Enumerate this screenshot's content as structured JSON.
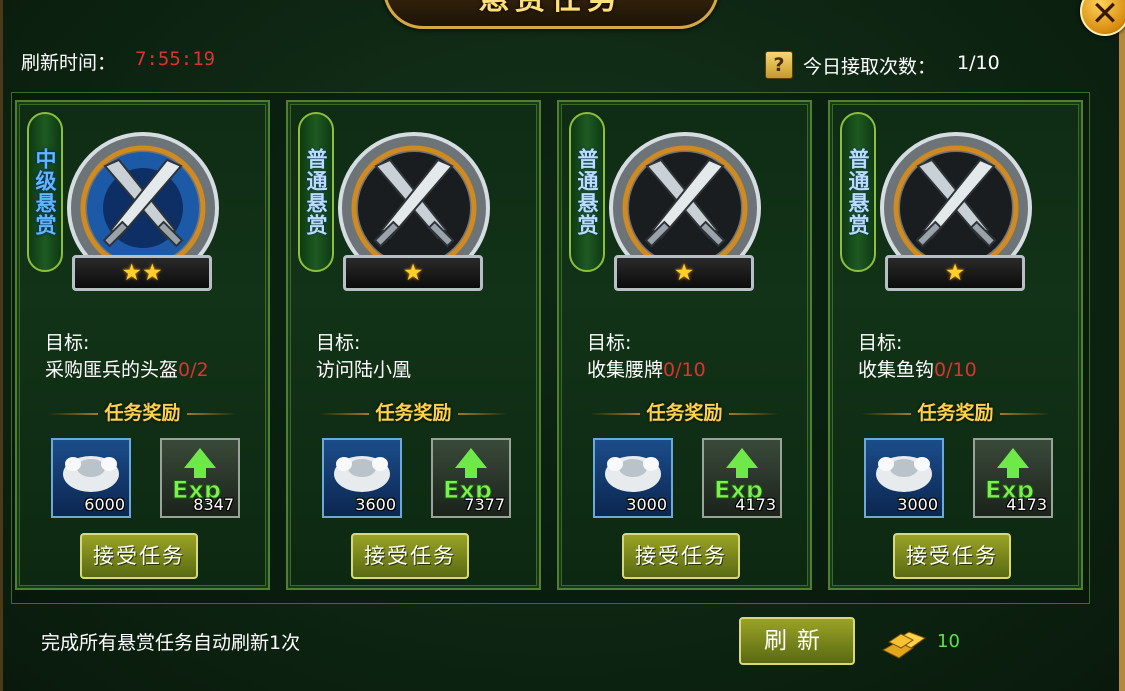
{
  "header": {
    "title": "悬赏任务",
    "refresh_label": "刷新时间：",
    "refresh_time": "7:55:19",
    "help_icon": "?",
    "daily_label": "今日接取次数：",
    "daily_count": "1/10"
  },
  "quests": [
    {
      "grade": "中级悬赏",
      "stars": "★★",
      "goal_label": "目标:",
      "goal": "采购匪兵的头盔",
      "progress": "0/2",
      "reward_title": "任务奖励",
      "silver": "6000",
      "exp": "8347",
      "accept": "接受任务"
    },
    {
      "grade": "普通悬赏",
      "stars": "★",
      "goal_label": "目标:",
      "goal": "访问陆小凰",
      "progress": "",
      "reward_title": "任务奖励",
      "silver": "3600",
      "exp": "7377",
      "accept": "接受任务"
    },
    {
      "grade": "普通悬赏",
      "stars": "★",
      "goal_label": "目标:",
      "goal": "收集腰牌",
      "progress": "0/10",
      "reward_title": "任务奖励",
      "silver": "3000",
      "exp": "4173",
      "accept": "接受任务"
    },
    {
      "grade": "普通悬赏",
      "stars": "★",
      "goal_label": "目标:",
      "goal": "收集鱼钩",
      "progress": "0/10",
      "reward_title": "任务奖励",
      "silver": "3000",
      "exp": "4173",
      "accept": "接受任务"
    }
  ],
  "footer": {
    "note": "完成所有悬赏任务自动刷新1次",
    "refresh_button": "刷新",
    "gold_cost": "10"
  },
  "colors": {
    "accent_gold": "#ffd14a",
    "progress_red": "#e03030",
    "cost_green": "#5fe04a"
  }
}
